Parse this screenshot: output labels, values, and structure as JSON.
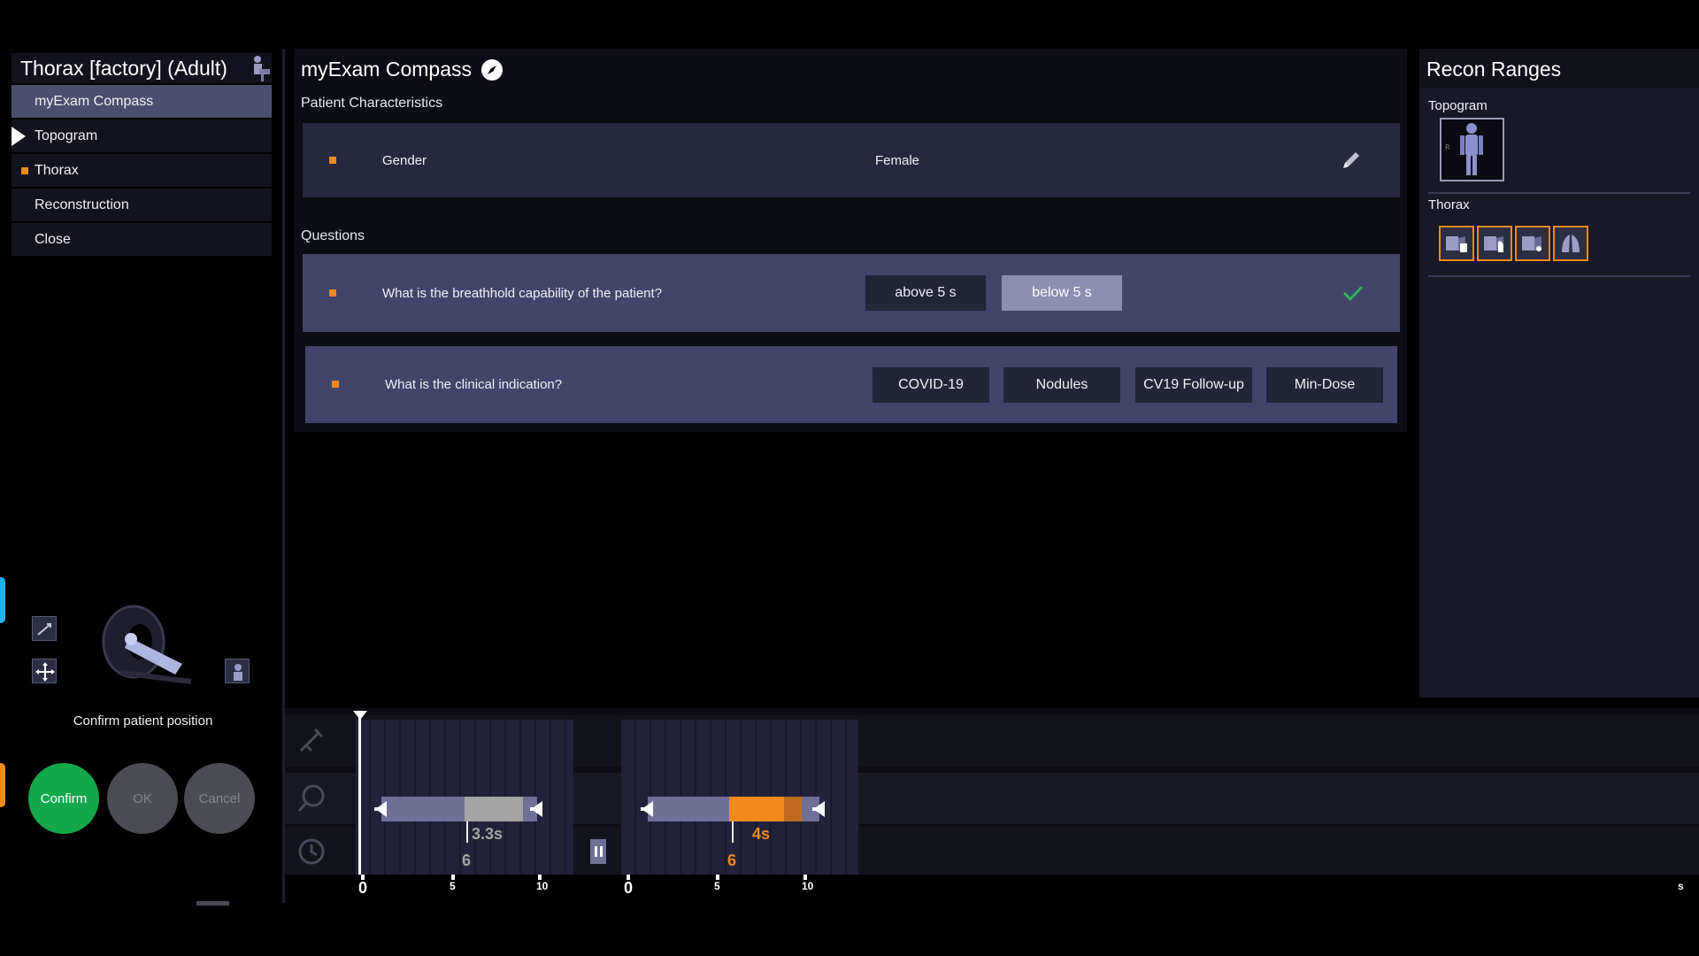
{
  "left_panel": {
    "exam_title": "Thorax [factory] (Adult)",
    "workflow": [
      {
        "label": "myExam Compass",
        "state": "active"
      },
      {
        "label": "Topogram",
        "state": "current"
      },
      {
        "label": "Thorax",
        "state": "pending"
      },
      {
        "label": "Reconstruction",
        "state": "normal"
      },
      {
        "label": "Close",
        "state": "normal"
      }
    ],
    "confirm_text": "Confirm patient position",
    "buttons": {
      "confirm": "Confirm",
      "ok": "OK",
      "cancel": "Cancel"
    }
  },
  "center": {
    "title": "myExam Compass",
    "patient_section": "Patient Characteristics",
    "gender": {
      "label": "Gender",
      "value": "Female"
    },
    "questions_section": "Questions",
    "questions": [
      {
        "text": "What is the breathhold capability of the patient?",
        "options": [
          "above 5 s",
          "below 5 s"
        ],
        "selected": "below 5 s"
      },
      {
        "text": "What is the clinical indication?",
        "options": [
          "COVID-19",
          "Nodules",
          "CV19  Follow-up",
          "Min-Dose"
        ]
      }
    ]
  },
  "right_panel": {
    "title": "Recon Ranges",
    "topogram_label": "Topogram",
    "thorax_label": "Thorax"
  },
  "timeline": {
    "scan1": {
      "duration": "3.3s",
      "count": "6"
    },
    "scan2": {
      "duration": "4s",
      "count": "6"
    },
    "axis1": [
      "0",
      "5",
      "10"
    ],
    "axis2": [
      "0",
      "5",
      "10"
    ],
    "unit": "s"
  },
  "colors": {
    "accent": "#f08a1c",
    "confirm": "#13a84a",
    "selected": "#8c8eb0",
    "check": "#2fb45a"
  }
}
